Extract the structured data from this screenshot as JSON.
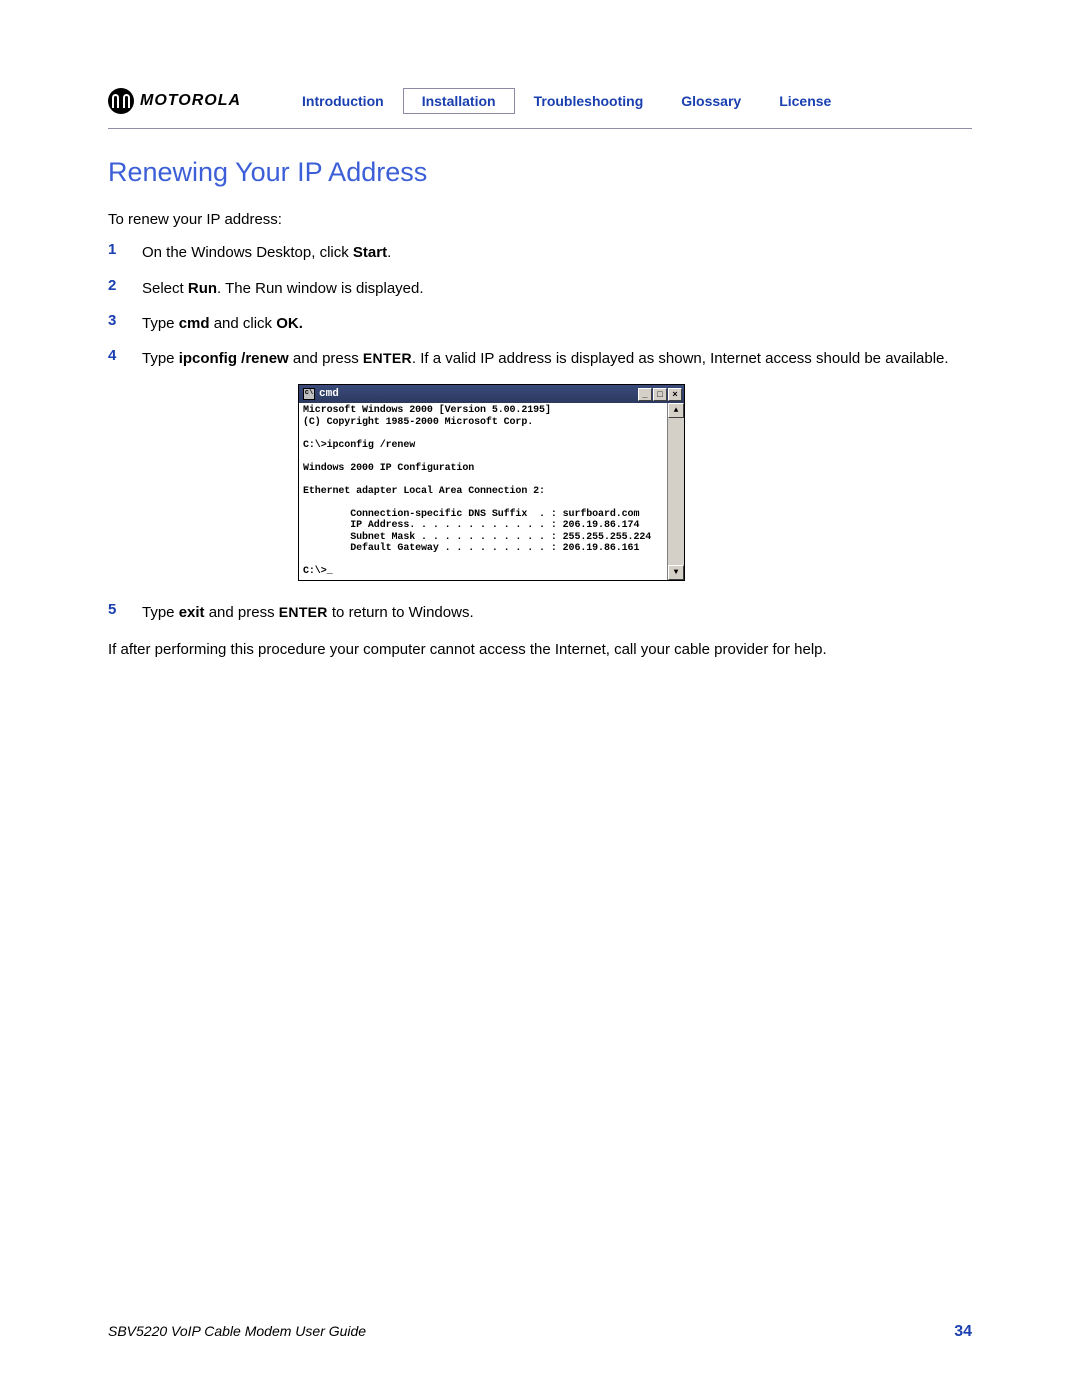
{
  "header": {
    "brand": "MOTOROLA",
    "nav": [
      {
        "label": "Introduction",
        "active": false
      },
      {
        "label": "Installation",
        "active": true
      },
      {
        "label": "Troubleshooting",
        "active": false
      },
      {
        "label": "Glossary",
        "active": false
      },
      {
        "label": "License",
        "active": false
      }
    ]
  },
  "title": "Renewing Your IP Address",
  "intro": "To renew your IP address:",
  "steps": {
    "s1": {
      "num": "1",
      "t1": "On the Windows Desktop, click ",
      "b1": "Start",
      "t2": "."
    },
    "s2": {
      "num": "2",
      "t1": "Select ",
      "b1": "Run",
      "t2": ". The Run window is displayed."
    },
    "s3": {
      "num": "3",
      "t1": "Type ",
      "b1": "cmd",
      "t2": " and click ",
      "b2": "OK."
    },
    "s4": {
      "num": "4",
      "t1": "Type ",
      "b1": "ipconfig /renew",
      "t2": " and press ",
      "sc": "ENTER",
      "t3": ". If a valid IP address is displayed as shown, Internet access should be available."
    },
    "s5": {
      "num": "5",
      "t1": "Type ",
      "b1": "exit",
      "t2": " and press ",
      "sc": "ENTER",
      "t3": " to return to Windows."
    }
  },
  "cmd": {
    "title": "cmd",
    "lines": "Microsoft Windows 2000 [Version 5.00.2195]\n(C) Copyright 1985-2000 Microsoft Corp.\n\nC:\\>ipconfig /renew\n\nWindows 2000 IP Configuration\n\nEthernet adapter Local Area Connection 2:\n\n        Connection-specific DNS Suffix  . : surfboard.com\n        IP Address. . . . . . . . . . . . : 206.19.86.174\n        Subnet Mask . . . . . . . . . . . : 255.255.255.224\n        Default Gateway . . . . . . . . . : 206.19.86.161\n\nC:\\>_"
  },
  "closing": "If after performing this procedure your computer cannot access the Internet, call your cable provider for help.",
  "footer": {
    "guide": "SBV5220 VoIP Cable Modem User Guide",
    "page": "34"
  }
}
